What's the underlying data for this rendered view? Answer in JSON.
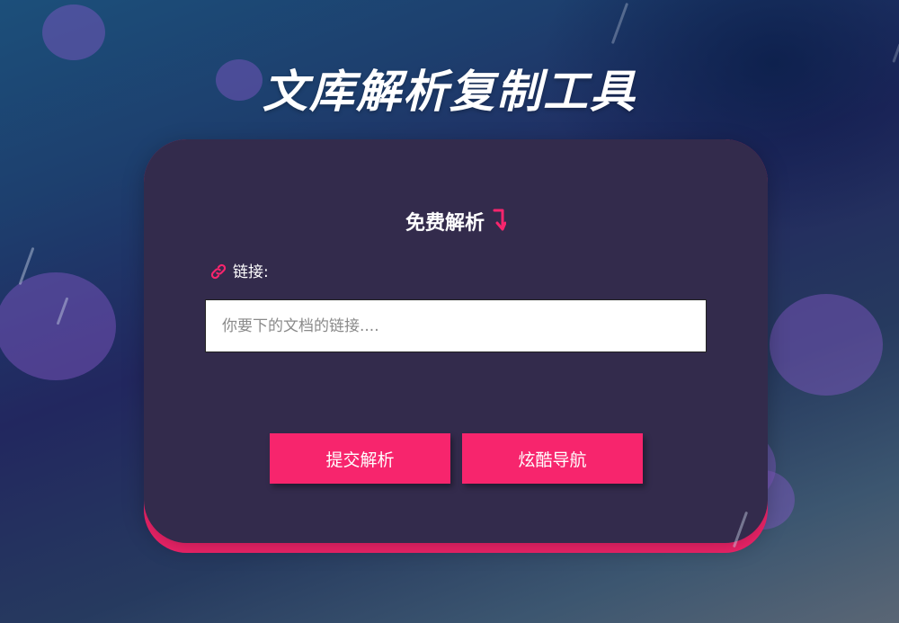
{
  "header": {
    "title": "文库解析复制工具"
  },
  "card": {
    "heading": "免费解析",
    "heading_icon": "arrow-down-icon",
    "link_field": {
      "icon": "link-icon",
      "label": "链接:",
      "placeholder": "你要下的文档的链接....",
      "value": ""
    },
    "buttons": {
      "submit_label": "提交解析",
      "nav_label": "炫酷导航"
    }
  },
  "colors": {
    "accent": "#f7256d",
    "card_background": "#1c3048",
    "text": "#ffffff"
  }
}
